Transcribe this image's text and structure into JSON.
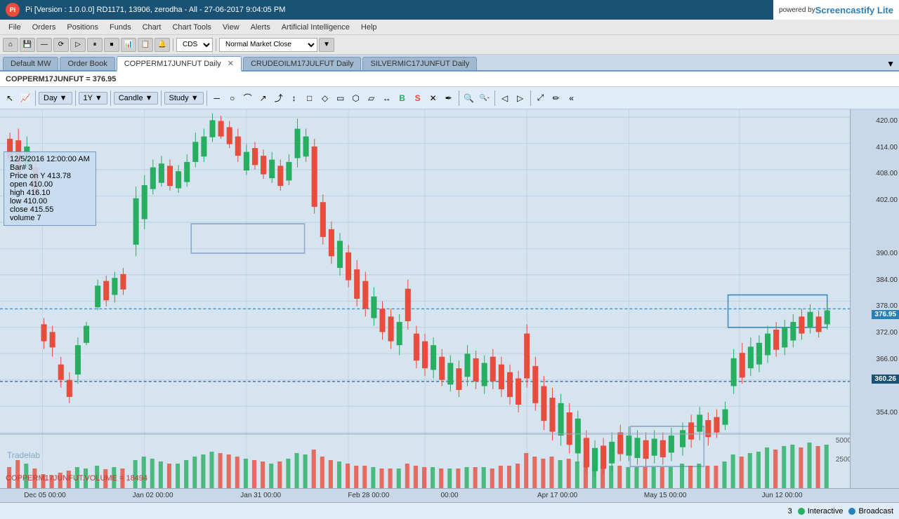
{
  "titlebar": {
    "logo": "Pi",
    "title": "Pi [Version : 1.0.0.0] RD1171, 13906, zerodha - All - 27-06-2017 9:04:05 PM",
    "powered_by": "powered by",
    "powered_name": "Screencastify Lite"
  },
  "menubar": {
    "items": [
      "File",
      "Orders",
      "Positions",
      "Funds",
      "Chart",
      "Chart Tools",
      "View",
      "Alerts",
      "Artificial Intelligence",
      "Help"
    ]
  },
  "toolbar": {
    "exchange": "CDS",
    "order_type": "Normal Market Close"
  },
  "tabs": {
    "items": [
      {
        "label": "Default MW",
        "active": false,
        "closeable": false
      },
      {
        "label": "Order Book",
        "active": false,
        "closeable": false
      },
      {
        "label": "COPPERM17JUNFUT Daily",
        "active": true,
        "closeable": true
      },
      {
        "label": "CRUDEOILM17JULFUT Daily",
        "active": false,
        "closeable": false
      },
      {
        "label": "SILVERMIC17JUNFUT Daily",
        "active": false,
        "closeable": false
      }
    ]
  },
  "tickerbar": {
    "text": "COPPERM17JUNFUT = 376.95"
  },
  "charttoolbar": {
    "nav_icon": "↖",
    "timeframe": "Day",
    "period": "1Y",
    "candle": "Candle",
    "study": "Study",
    "drawing_tools": [
      "─",
      "○",
      "⌒",
      "↗",
      "⤴",
      "↕",
      "□",
      "◇",
      "▭",
      "⬡",
      "▭",
      "↔",
      "B",
      "S",
      "×",
      "↗"
    ],
    "zoom_in": "🔍+",
    "zoom_out": "🔍-",
    "left": "<",
    "right": ">",
    "expand": "⤢",
    "draw": "✏",
    "menu": "<<"
  },
  "tooltip": {
    "date": "12/5/2016 12:00:00 AM",
    "bar": "Bar# 3",
    "price_on_y": "Price on Y  413.78",
    "open": "open  410.00",
    "high": "high  416.10",
    "low": "low   410.00",
    "close": "close  415.55",
    "volume": "volume 7"
  },
  "price_axis": {
    "labels": [
      {
        "value": "420.00",
        "top_pct": 2
      },
      {
        "value": "414.00",
        "top_pct": 9
      },
      {
        "value": "408.00",
        "top_pct": 16
      },
      {
        "value": "402.00",
        "top_pct": 23
      },
      {
        "value": "390.00",
        "top_pct": 37
      },
      {
        "value": "384.00",
        "top_pct": 44
      },
      {
        "value": "378.00",
        "top_pct": 51
      },
      {
        "value": "376.95",
        "top_pct": 53,
        "highlight": true,
        "color": "#2980b9"
      },
      {
        "value": "372.00",
        "top_pct": 58
      },
      {
        "value": "366.00",
        "top_pct": 65
      },
      {
        "value": "360.26",
        "top_pct": 72,
        "highlight": true,
        "color": "#1a5276"
      },
      {
        "value": "354.00",
        "top_pct": 79
      }
    ]
  },
  "time_axis": {
    "labels": [
      {
        "text": "Dec 05 00:00",
        "left_pct": 5
      },
      {
        "text": "Jan 02 00:00",
        "left_pct": 17
      },
      {
        "text": "Jan 31 00:00",
        "left_pct": 29
      },
      {
        "text": "Feb 28 00:00",
        "left_pct": 41
      },
      {
        "text": "00:00",
        "left_pct": 50
      },
      {
        "text": "Apr 17 00:00",
        "left_pct": 62
      },
      {
        "text": "May 15 00:00",
        "left_pct": 74
      },
      {
        "text": "Jun 12 00:00",
        "left_pct": 87
      }
    ]
  },
  "watermark": {
    "text": "Tradelab"
  },
  "volume_label": {
    "text": "COPPERM17JUNFUT.VOLUME = 18494"
  },
  "statusbar": {
    "page": "3",
    "interactive_label": "Interactive",
    "broadcast_label": "Broadcast"
  },
  "colors": {
    "bull": "#27ae60",
    "bear": "#e74c3c",
    "accent": "#2980b9",
    "background": "#d6e4f0",
    "chart_bg": "#d6e4f0",
    "grid": "rgba(150,180,210,0.4)"
  }
}
